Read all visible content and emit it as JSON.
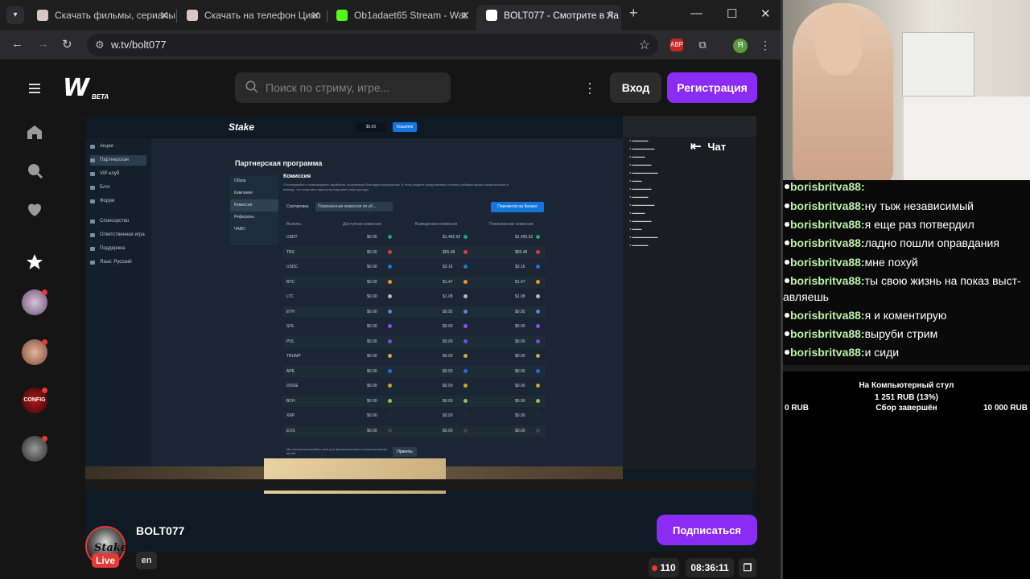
{
  "browser": {
    "tabs": [
      {
        "title": "Скачать фильмы, сериалы",
        "active": false
      },
      {
        "title": "Скачать на телефон Цикл",
        "active": false
      },
      {
        "title": "Ob1adaet65 Stream - Wat",
        "active": false
      },
      {
        "title": "BOLT077 - Смотрите в Ла",
        "active": true
      }
    ],
    "url": "w.tv/bolt077",
    "profile_letter": "Я",
    "ext_label": "ABP"
  },
  "site": {
    "logo": "W",
    "logo_badge": "BETA",
    "search_placeholder": "Поиск по стриму, игре...",
    "login_label": "Вход",
    "register_label": "Регистрация",
    "chat_label": "Чат"
  },
  "sidebar": {
    "icons": [
      "menu-icon",
      "home-icon",
      "search-icon",
      "heart-icon",
      "star-icon"
    ],
    "avatar_badge": "CONFIG"
  },
  "stream_content": {
    "page_title": "Партнерская программа",
    "brand": "Stake",
    "section": "Комиссия",
    "description": "Отслеживайте и анализируйте заработок, полученный благодаря рефералам. В этом разделе представлены полные разбивки ваших комиссионных и вывода, что позволяет вам контролировать свои доходы.",
    "side_menu": [
      "Акции",
      "Партнерская",
      "VIP-клуб",
      "Блог",
      "Форум",
      "Спонсорство",
      "Ответственная игра",
      "Поддержка",
      "Язык: Русский"
    ],
    "tabs": [
      "Обзор",
      "Кампании",
      "Комиссия",
      "Рефералы",
      "ЧАВО"
    ],
    "columns": [
      "Валюты",
      "Доступная комиссия",
      "Выведенная комиссия",
      "Пожизненная комиссия"
    ],
    "rows": [
      {
        "cur": "USDT",
        "avail": "$0.00",
        "out": "$1,492.92",
        "life": "$1,492.92"
      },
      {
        "cur": "TRX",
        "avail": "$0.00",
        "out": "$55.48",
        "life": "$55.48"
      },
      {
        "cur": "USDC",
        "avail": "$0.00",
        "out": "$3.16",
        "life": "$3.16"
      },
      {
        "cur": "BTC",
        "avail": "$0.00",
        "out": "$1.47",
        "life": "$1.47"
      },
      {
        "cur": "LTC",
        "avail": "$0.00",
        "out": "$1.08",
        "life": "$1.08"
      },
      {
        "cur": "ETH",
        "avail": "$0.00",
        "out": "$0.92",
        "life": "$0.92"
      },
      {
        "cur": "SOL",
        "avail": "$0.00",
        "out": "$0.00",
        "life": "$0.00"
      },
      {
        "cur": "POL",
        "avail": "$0.00",
        "out": "$0.00",
        "life": "$0.00"
      },
      {
        "cur": "TRUMP",
        "avail": "$0.00",
        "out": "$0.00",
        "life": "$0.00"
      },
      {
        "cur": "APE",
        "avail": "$0.00",
        "out": "$0.00",
        "life": "$0.00"
      },
      {
        "cur": "DOGE",
        "avail": "$0.00",
        "out": "$0.00",
        "life": "$0.00"
      },
      {
        "cur": "BCH",
        "avail": "$0.00",
        "out": "$0.00",
        "life": "$0.00"
      },
      {
        "cur": "XRP",
        "avail": "$0.00",
        "out": "$0.00",
        "life": "$0.00"
      },
      {
        "cur": "EOS",
        "avail": "$0.00",
        "out": "$0.00",
        "life": "$0.00"
      }
    ],
    "sort_label": "Сортировка",
    "sort_value": "Пожизненная комиссия по уб...",
    "balance_btn": "Перевести на баланс",
    "balance": "$0.00",
    "deposit_btn": "Кошелек",
    "accept_btn": "Принять",
    "cookie_text": "Мы используем файлы куки для функциональных и аналитических целей."
  },
  "channel": {
    "name": "BOLT077",
    "avatar_text": "Stake",
    "live_label": "Live",
    "language": "en",
    "subscribe_label": "Подписаться",
    "viewers": "110",
    "uptime": "08:36:11"
  },
  "overlay_chat": [
    {
      "user": "borisbritva88:",
      "msg": "ну тыж независимый"
    },
    {
      "user": "borisbritva88:",
      "msg": "я еще раз потвердил"
    },
    {
      "user": "borisbritva88:",
      "msg": "ладно пошли оправдания"
    },
    {
      "user": "borisbritva88:",
      "msg": "мне похуй"
    },
    {
      "user": "borisbritva88:",
      "msg": "ты свою жизнь на показ выст-"
    },
    {
      "user": "",
      "msg": "авляешь"
    },
    {
      "user": "borisbritva88:",
      "msg": "я и коментирую"
    },
    {
      "user": "borisbritva88:",
      "msg": "выруби стрим"
    },
    {
      "user": "borisbritva88:",
      "msg": "и сиди"
    }
  ],
  "overlay_chat_top": "borisbritva88:",
  "goal": {
    "title": "На Компьютерный стул",
    "value": "1 251 RUB (13%)",
    "progress": 0.13,
    "min": "0 RUB",
    "status": "Сбор завершён",
    "max": "10 000 RUB"
  },
  "colors": {
    "accent": "#8b2cf5",
    "live": "#e53935",
    "chat_name": "#b9f0a4"
  }
}
